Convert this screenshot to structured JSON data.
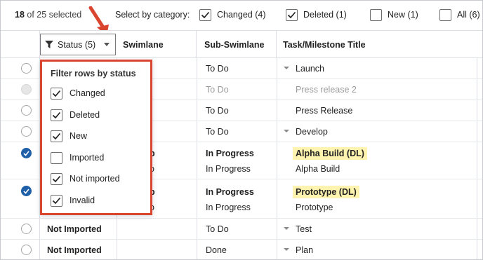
{
  "selection": {
    "count": "18",
    "suffix": "of 25 selected"
  },
  "category": {
    "label": "Select by category:",
    "options": [
      {
        "label": "Changed (4)",
        "checked": true
      },
      {
        "label": "Deleted (1)",
        "checked": true
      },
      {
        "label": "New (1)",
        "checked": false
      },
      {
        "label": "All (6)",
        "checked": false
      }
    ]
  },
  "columns": {
    "status": "Status (5)",
    "swimlane": "Swimlane",
    "subswimlane": "Sub-Swimlane",
    "title": "Task/Milestone Title"
  },
  "rows": [
    {
      "radio": "off",
      "status": "",
      "swimlane": "",
      "sub": "To Do",
      "title": "Launch",
      "caret": true
    },
    {
      "radio": "disabled",
      "status": "",
      "swimlane": "",
      "sub": "To Do",
      "title": "Press release 2",
      "muted": true
    },
    {
      "radio": "off",
      "status": "",
      "swimlane": "",
      "sub": "To Do",
      "title": "Press Release"
    },
    {
      "radio": "off",
      "status": "",
      "swimlane": "",
      "sub": "To Do",
      "title": "Develop",
      "caret": true
    },
    {
      "radio": "on",
      "swimlane": "p",
      "swimlane2": "o",
      "sub": "In Progress",
      "sub2": "In Progress",
      "title": "Alpha Build (DL)",
      "title2": "Alpha Build"
    },
    {
      "radio": "on",
      "swimlane": "p",
      "swimlane2": "o",
      "sub": "In Progress",
      "sub2": "In Progress",
      "title": "Prototype (DL)",
      "title2": "Prototype"
    },
    {
      "radio": "off",
      "status": "Not Imported",
      "swimlane": "",
      "sub": "To Do",
      "title": "Test",
      "caret": true
    },
    {
      "radio": "off",
      "status": "Not Imported",
      "swimlane": "",
      "sub": "Done",
      "title": "Plan",
      "caret": true
    }
  ],
  "filter_popup": {
    "title": "Filter rows by status",
    "items": [
      {
        "label": "Changed",
        "checked": true
      },
      {
        "label": "Deleted",
        "checked": true
      },
      {
        "label": "New",
        "checked": true
      },
      {
        "label": "Imported",
        "checked": false
      },
      {
        "label": "Not imported",
        "checked": true
      },
      {
        "label": "Invalid",
        "checked": true
      }
    ]
  },
  "colors": {
    "accent": "#1e5fa8",
    "callout": "#d9452f",
    "highlight": "#fff3b0"
  }
}
